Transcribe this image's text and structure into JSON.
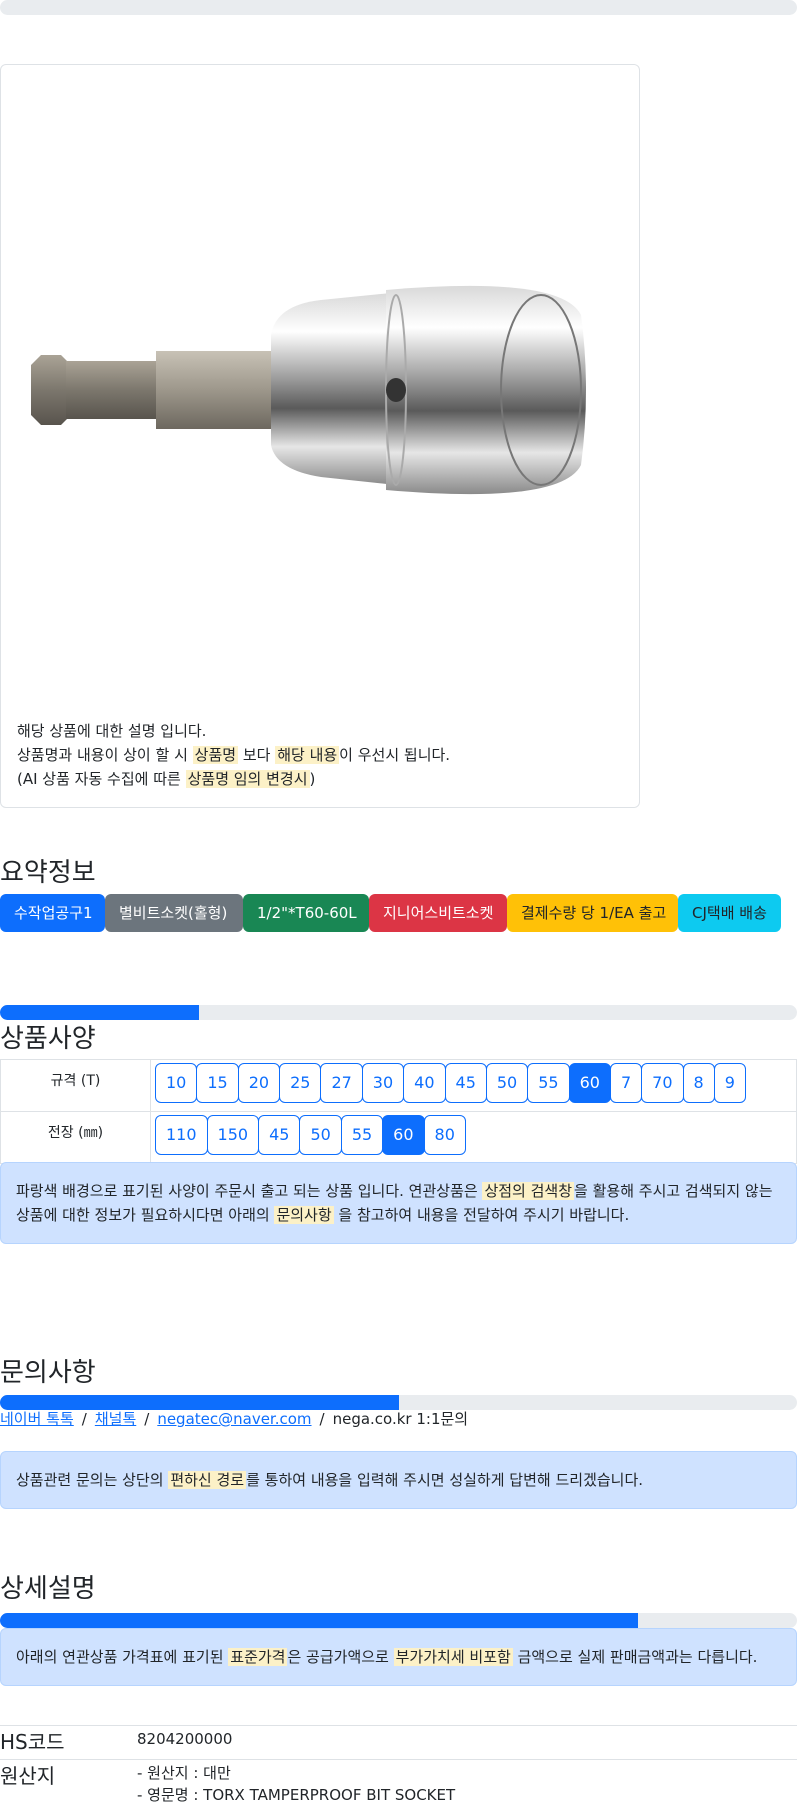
{
  "notice": {
    "line1": "해당 상품에 대한 설명 입니다.",
    "line2_a": "상품명과 내용이 상이 할 시 ",
    "line2_mark1": "상품명",
    "line2_b": " 보다 ",
    "line2_mark2": "해당 내용",
    "line2_c": "이 우선시 됩니다.",
    "line3_a": "(AI 상품 자동 수집에 따른 ",
    "line3_mark": "상품명 임의 변경시",
    "line3_b": ")"
  },
  "summary": {
    "title": "요약정보",
    "badges": [
      "수작업공구1",
      "별비트소켓(홀형)",
      "1/2\"*T60-60L",
      "지니어스비트소켓",
      "결제수량 당 1/EA 출고",
      "CJ택배 배송"
    ]
  },
  "specs": {
    "title": "상품사양",
    "progress_percent": 25,
    "rows": [
      {
        "label": "규격 (T)",
        "options": [
          "10",
          "15",
          "20",
          "25",
          "27",
          "30",
          "40",
          "45",
          "50",
          "55",
          "60",
          "7",
          "70",
          "8",
          "9"
        ],
        "selected": "60"
      },
      {
        "label": "전장 (㎜)",
        "options": [
          "110",
          "150",
          "45",
          "50",
          "55",
          "60",
          "80"
        ],
        "selected": "60"
      }
    ],
    "alert_a": "파랑색 배경으로 표기된 사양이 주문시 출고 되는 상품 입니다. 연관상품은 ",
    "alert_mark1": "상점의 검색창",
    "alert_b": "을 활용해 주시고 검색되지 않는 상품에 대한 정보가 필요하시다면 아래의 ",
    "alert_mark2": "문의사항",
    "alert_c": " 을 참고하여 내용을 전달하여 주시기 바랍니다."
  },
  "inquiry": {
    "title": "문의사항",
    "progress_percent": 50,
    "links": [
      "네이버 톡톡",
      "채널톡",
      "negatec@naver.com"
    ],
    "plain": "nega.co.kr 1:1문의",
    "separator": "/",
    "alert_a": "상품관련 문의는 상단의 ",
    "alert_mark": "편하신 경로",
    "alert_b": "를 통하여 내용을 입력해 주시면 성실하게 답변해 드리겠습니다."
  },
  "detail": {
    "title": "상세설명",
    "progress_percent": 80,
    "alert_a": "아래의 연관상품 가격표에 표기된 ",
    "alert_mark1": "표준가격",
    "alert_b": "은 공급가액으로 ",
    "alert_mark2": "부가가치세 비포함",
    "alert_c": " 금액으로 실제 판매금액과는 다릅니다.",
    "hs_label": "HS코드",
    "hs_value": "8204200000",
    "origin_label": "원산지",
    "origin_line1": "- 원산지 : 대만",
    "origin_line2": "- 영문명 : TORX TAMPERPROOF BIT SOCKET"
  },
  "top_progress_percent": 0,
  "colors": {
    "primary": "#0d6efd",
    "alert_bg": "#cfe2ff",
    "mark_bg": "#fcf1c7"
  }
}
